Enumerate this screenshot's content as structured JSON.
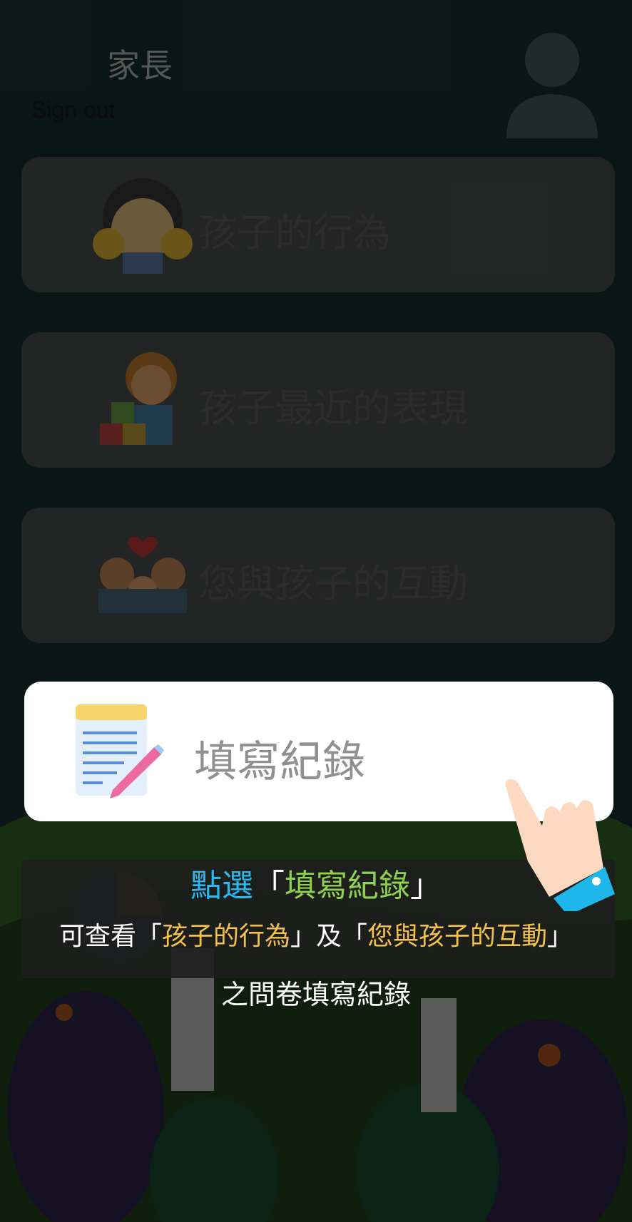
{
  "header": {
    "title": "家長",
    "signout_label": "Sign out"
  },
  "menu": [
    {
      "label": "孩子的行為",
      "icon": "child-face-icon"
    },
    {
      "label": "孩子最近的表現",
      "icon": "boy-with-blocks-icon"
    },
    {
      "label": "您與孩子的互動",
      "icon": "family-icon"
    },
    {
      "label": "填寫紀錄",
      "icon": "notepad-pencil-icon"
    }
  ],
  "hint": {
    "line1_prefix": "點選",
    "line1_open": "「",
    "line1_highlight": "填寫紀錄",
    "line1_close": "」",
    "line2_prefix": "可查看「",
    "line2_item1": "孩子的行為",
    "line2_mid": "」及「",
    "line2_item2": "您與孩子的互動",
    "line2_close": "」",
    "line3": "之問卷填寫紀錄"
  },
  "colors": {
    "highlight_blue": "#29b8f0",
    "highlight_green": "#8fd14f",
    "highlight_yellow": "#f2c14e",
    "card_active_bg": "#ffffff"
  }
}
